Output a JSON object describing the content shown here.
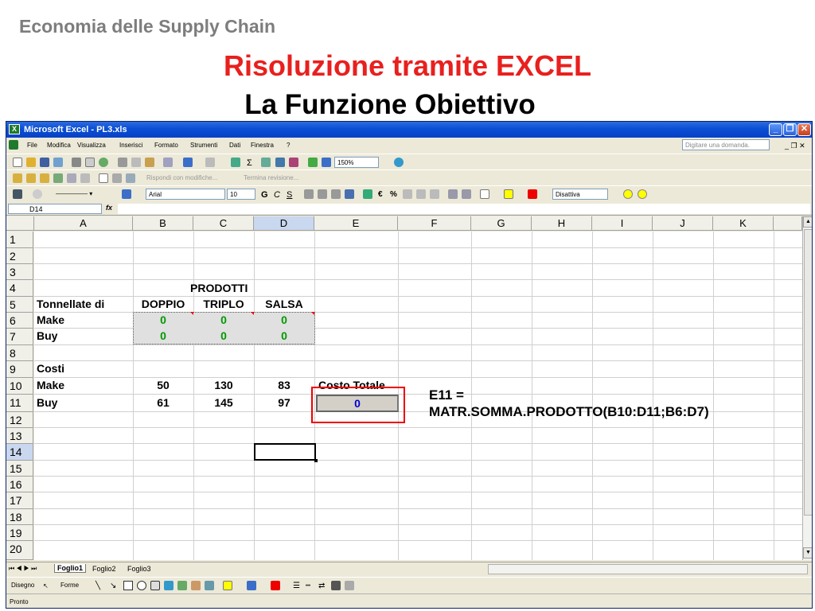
{
  "slide": {
    "subtitle": "Economia delle Supply Chain",
    "title": "Risoluzione tramite EXCEL",
    "title2": "La Funzione Obiettivo",
    "note_line1": "E11 =",
    "note_line2": "MATR.SOMMA.PRODOTTO(B10:D11;B6:D7)"
  },
  "window": {
    "title": "Microsoft Excel - PL3.xls",
    "minimize": "_",
    "restore": "❐",
    "close": "✕"
  },
  "menu": [
    "File",
    "Modifica",
    "Visualizza",
    "Inserisci",
    "Formato",
    "Strumenti",
    "Dati",
    "Finestra",
    "?"
  ],
  "help_placeholder": "Digitare una domanda.",
  "toolbar": {
    "zoom": "150%",
    "review_reply": "Rispondi con modifiche...",
    "review_end": "Termina revisione...",
    "font": "Arial",
    "size": "10",
    "style": "Disattiva"
  },
  "namebox": "D14",
  "fx": "fx",
  "columns": [
    "A",
    "B",
    "C",
    "D",
    "E",
    "F",
    "G",
    "H",
    "I",
    "J",
    "K"
  ],
  "rows": [
    "1",
    "2",
    "3",
    "4",
    "5",
    "6",
    "7",
    "8",
    "9",
    "10",
    "11",
    "12",
    "13",
    "14",
    "15",
    "16",
    "17",
    "18",
    "19",
    "20"
  ],
  "cells": {
    "c4": "PRODOTTI",
    "a5": "Tonnellate di",
    "b5": "DOPPIO",
    "c5": "TRIPLO",
    "d5": "SALSA",
    "a6": "Make",
    "b6": "0",
    "c6": "0",
    "d6": "0",
    "a7": "Buy",
    "b7": "0",
    "c7": "0",
    "d7": "0",
    "a9": "Costi",
    "a10": "Make",
    "b10": "50",
    "c10": "130",
    "d10": "83",
    "e10": "Costo Totale",
    "a11": "Buy",
    "b11": "61",
    "c11": "145",
    "d11": "97",
    "e11": "0"
  },
  "sheets": {
    "tab1": "Foglio1",
    "tab2": "Foglio2",
    "tab3": "Foglio3"
  },
  "drawing": {
    "draw": "Disegno",
    "shapes": "Forme"
  },
  "status": "Pronto"
}
